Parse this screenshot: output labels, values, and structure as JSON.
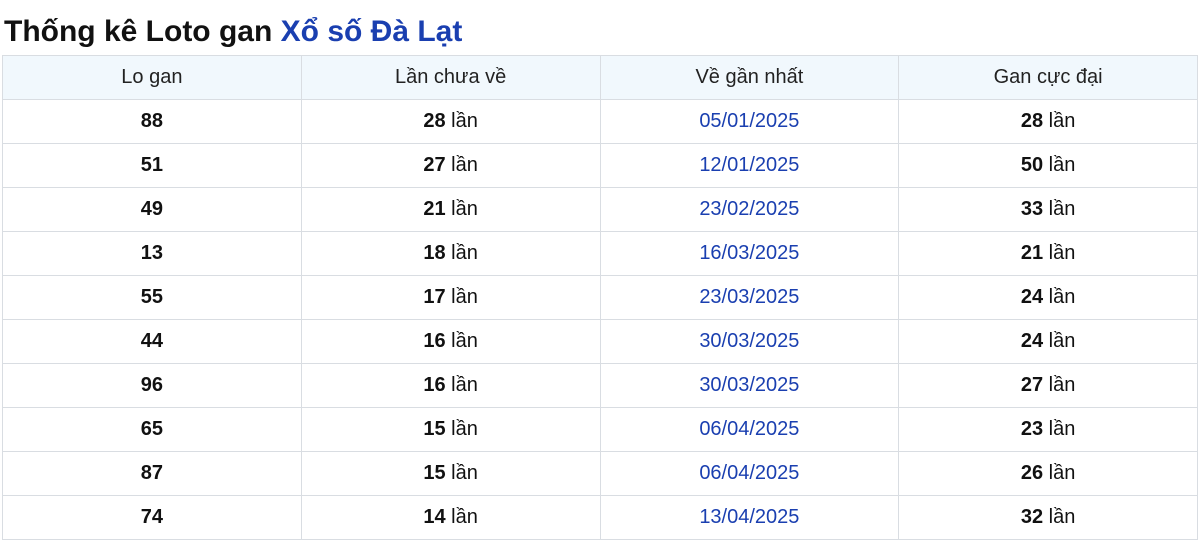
{
  "header": {
    "title_prefix": "Thống kê Loto gan",
    "title_lottery": "Xổ số Đà Lạt"
  },
  "colors": {
    "accent": "#1a3fb0",
    "header_bg": "#f1f8fd",
    "border": "#d9dde2"
  },
  "table": {
    "columns": [
      "Lo gan",
      "Lần chưa về",
      "Về gần nhất",
      "Gan cực đại"
    ],
    "unit": "lần",
    "rows": [
      {
        "number": "88",
        "missed": "28",
        "last_date": "05/01/2025",
        "max_gan": "28"
      },
      {
        "number": "51",
        "missed": "27",
        "last_date": "12/01/2025",
        "max_gan": "50"
      },
      {
        "number": "49",
        "missed": "21",
        "last_date": "23/02/2025",
        "max_gan": "33"
      },
      {
        "number": "13",
        "missed": "18",
        "last_date": "16/03/2025",
        "max_gan": "21"
      },
      {
        "number": "55",
        "missed": "17",
        "last_date": "23/03/2025",
        "max_gan": "24"
      },
      {
        "number": "44",
        "missed": "16",
        "last_date": "30/03/2025",
        "max_gan": "24"
      },
      {
        "number": "96",
        "missed": "16",
        "last_date": "30/03/2025",
        "max_gan": "27"
      },
      {
        "number": "65",
        "missed": "15",
        "last_date": "06/04/2025",
        "max_gan": "23"
      },
      {
        "number": "87",
        "missed": "15",
        "last_date": "06/04/2025",
        "max_gan": "26"
      },
      {
        "number": "74",
        "missed": "14",
        "last_date": "13/04/2025",
        "max_gan": "32"
      }
    ]
  }
}
